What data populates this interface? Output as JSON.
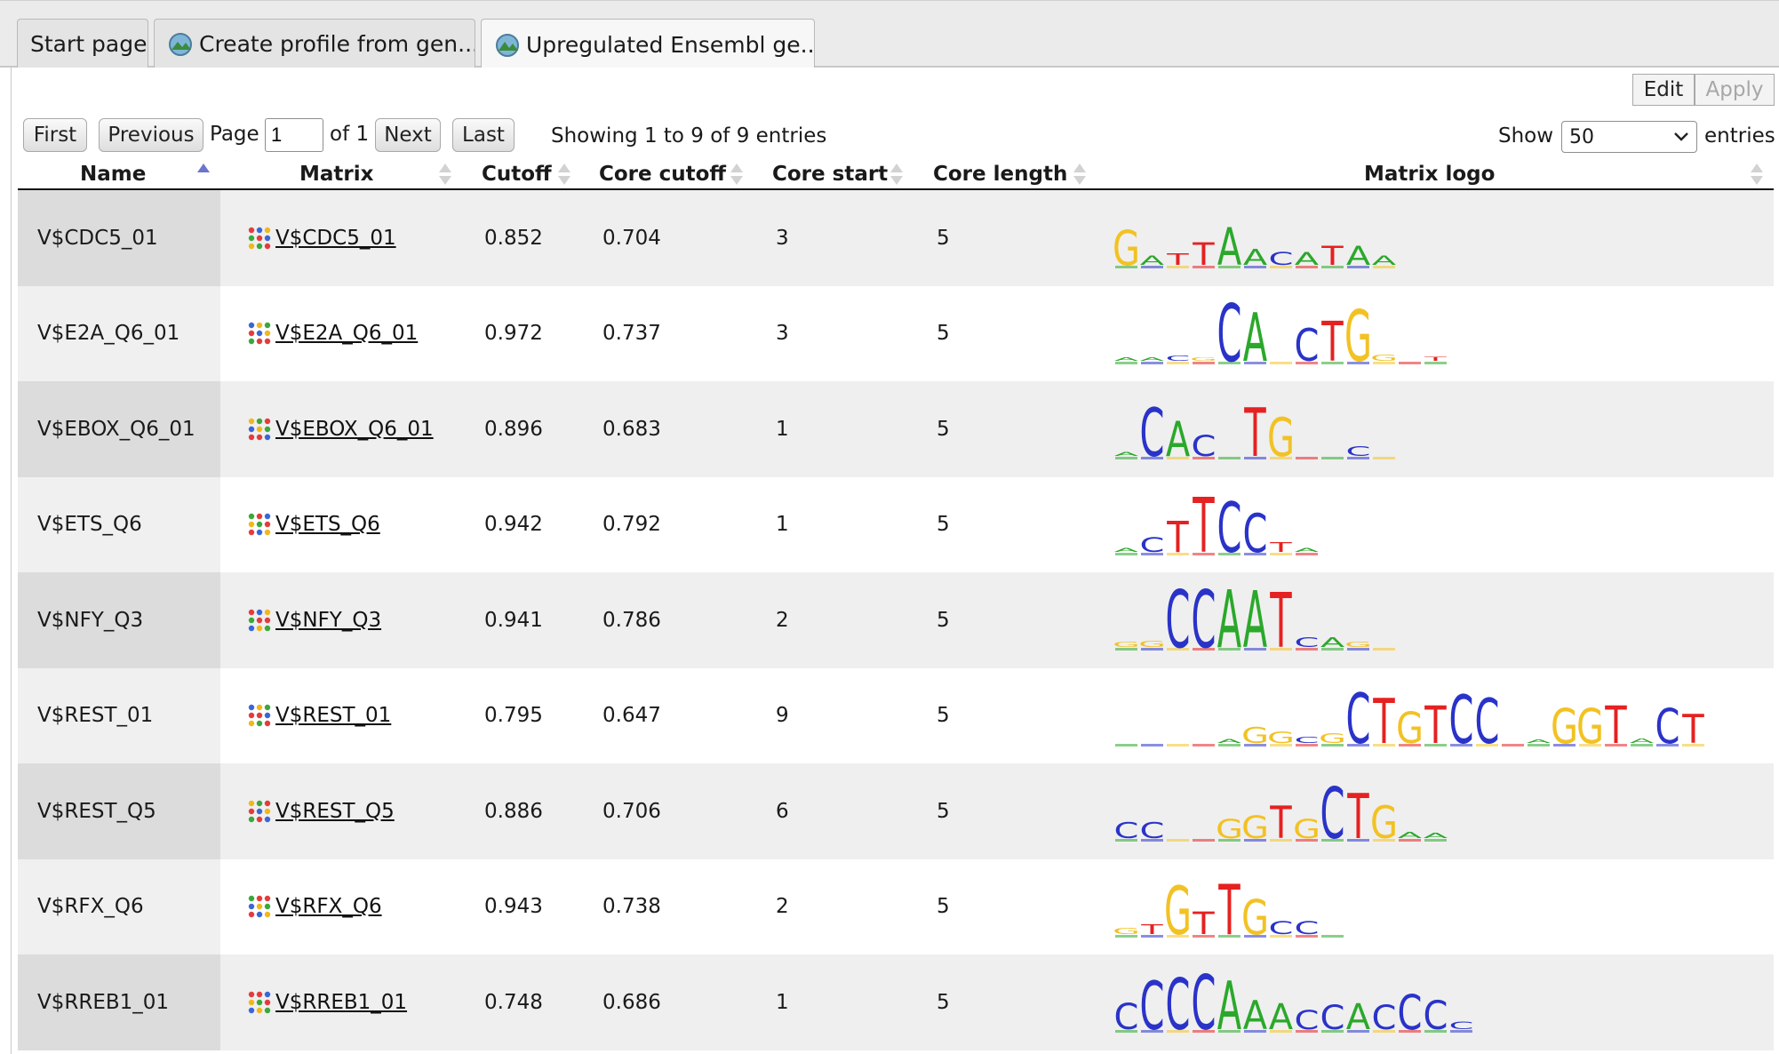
{
  "tabs": [
    {
      "label": "Start page"
    },
    {
      "label": "Create profile from gen...",
      "close": "X"
    },
    {
      "label": "Upregulated Ensembl ge...",
      "close": "X"
    }
  ],
  "toolbar": {
    "edit_label": "Edit",
    "apply_label": "Apply"
  },
  "pager": {
    "first": "First",
    "previous": "Previous",
    "page_label": "Page",
    "page_value": "1",
    "of_label": "of 1",
    "next": "Next",
    "last": "Last",
    "info": "Showing 1 to 9 of 9 entries",
    "show_label": "Show",
    "show_value": "50",
    "entries_label": "entries"
  },
  "columns": {
    "name": "Name",
    "matrix": "Matrix",
    "cutoff": "Cutoff",
    "core_cutoff": "Core cutoff",
    "core_start": "Core start",
    "core_length": "Core length",
    "matrix_logo": "Matrix logo"
  },
  "colors": {
    "A": "#2ba82b",
    "C": "#2a33c8",
    "G": "#f2c224",
    "T": "#e52121"
  },
  "rows": [
    {
      "name": "V$CDC5_01",
      "matrix": "V$CDC5_01",
      "cutoff": "0.852",
      "core_cutoff": "0.704",
      "core_start": "3",
      "core_length": "5",
      "logo": [
        [
          "G",
          0.55
        ],
        [
          "A",
          0.14
        ],
        [
          "T",
          0.18
        ],
        [
          "T",
          0.35
        ],
        [
          "A",
          0.58
        ],
        [
          "A",
          0.25
        ],
        [
          "C",
          0.2
        ],
        [
          "A",
          0.2
        ],
        [
          "T",
          0.3
        ],
        [
          "A",
          0.3
        ],
        [
          "A",
          0.14
        ]
      ]
    },
    {
      "name": "V$E2A_Q6_01",
      "matrix": "V$E2A_Q6_01",
      "cutoff": "0.972",
      "core_cutoff": "0.737",
      "core_start": "3",
      "core_length": "5",
      "logo": [
        [
          "A",
          0.05
        ],
        [
          "A",
          0.05
        ],
        [
          "C",
          0.08
        ],
        [
          "G",
          0.05
        ],
        [
          "C",
          0.9
        ],
        [
          "A",
          0.75
        ],
        [
          "_",
          0.05
        ],
        [
          "C",
          0.5
        ],
        [
          "T",
          0.62
        ],
        [
          "G",
          0.8
        ],
        [
          "G",
          0.1
        ],
        [
          "_",
          0.0
        ],
        [
          "T",
          0.06
        ]
      ]
    },
    {
      "name": "V$EBOX_Q6_01",
      "matrix": "V$EBOX_Q6_01",
      "cutoff": "0.896",
      "core_cutoff": "0.683",
      "core_start": "1",
      "core_length": "5",
      "logo": [
        [
          "A",
          0.06
        ],
        [
          "C",
          0.75
        ],
        [
          "A",
          0.55
        ],
        [
          "C",
          0.32
        ],
        [
          "_",
          0.05
        ],
        [
          "T",
          0.75
        ],
        [
          "G",
          0.6
        ],
        [
          "_",
          0.03
        ],
        [
          "_",
          0.03
        ],
        [
          "C",
          0.15
        ],
        [
          "_",
          0.03
        ]
      ]
    },
    {
      "name": "V$ETS_Q6",
      "matrix": "V$ETS_Q6",
      "cutoff": "0.942",
      "core_cutoff": "0.792",
      "core_start": "1",
      "core_length": "5",
      "logo": [
        [
          "A",
          0.06
        ],
        [
          "C",
          0.22
        ],
        [
          "T",
          0.48
        ],
        [
          "T",
          0.85
        ],
        [
          "C",
          0.78
        ],
        [
          "C",
          0.6
        ],
        [
          "T",
          0.15
        ],
        [
          "A",
          0.06
        ]
      ]
    },
    {
      "name": "V$NFY_Q3",
      "matrix": "V$NFY_Q3",
      "cutoff": "0.941",
      "core_cutoff": "0.786",
      "core_start": "2",
      "core_length": "5",
      "logo": [
        [
          "G",
          0.08
        ],
        [
          "G",
          0.1
        ],
        [
          "C",
          0.9
        ],
        [
          "C",
          0.9
        ],
        [
          "A",
          0.9
        ],
        [
          "A",
          0.88
        ],
        [
          "T",
          0.85
        ],
        [
          "C",
          0.15
        ],
        [
          "A",
          0.15
        ],
        [
          "G",
          0.08
        ],
        [
          "_",
          0.04
        ]
      ]
    },
    {
      "name": "V$REST_01",
      "matrix": "V$REST_01",
      "cutoff": "0.795",
      "core_cutoff": "0.647",
      "core_start": "9",
      "core_length": "5",
      "logo": [
        [
          "_",
          0.02
        ],
        [
          "_",
          0.02
        ],
        [
          "_",
          0.0
        ],
        [
          "_",
          0.0
        ],
        [
          "A",
          0.06
        ],
        [
          "G",
          0.25
        ],
        [
          "G",
          0.18
        ],
        [
          "C",
          0.1
        ],
        [
          "G",
          0.15
        ],
        [
          "C",
          0.78
        ],
        [
          "T",
          0.7
        ],
        [
          "G",
          0.48
        ],
        [
          "T",
          0.58
        ],
        [
          "C",
          0.75
        ],
        [
          "C",
          0.7
        ],
        [
          "_",
          0.05
        ],
        [
          "A",
          0.05
        ],
        [
          "G",
          0.55
        ],
        [
          "G",
          0.55
        ],
        [
          "T",
          0.58
        ],
        [
          "A",
          0.07
        ],
        [
          "C",
          0.55
        ],
        [
          "T",
          0.45
        ]
      ]
    },
    {
      "name": "V$REST_Q5",
      "matrix": "V$REST_Q5",
      "cutoff": "0.886",
      "core_cutoff": "0.706",
      "core_start": "6",
      "core_length": "5",
      "logo": [
        [
          "C",
          0.25
        ],
        [
          "C",
          0.25
        ],
        [
          "_",
          0.0
        ],
        [
          "_",
          0.03
        ],
        [
          "G",
          0.3
        ],
        [
          "G",
          0.35
        ],
        [
          "T",
          0.5
        ],
        [
          "G",
          0.3
        ],
        [
          "C",
          0.8
        ],
        [
          "T",
          0.7
        ],
        [
          "G",
          0.5
        ],
        [
          "A",
          0.1
        ],
        [
          "A",
          0.08
        ]
      ]
    },
    {
      "name": "V$RFX_Q6",
      "matrix": "V$RFX_Q6",
      "cutoff": "0.943",
      "core_cutoff": "0.738",
      "core_start": "2",
      "core_length": "5",
      "logo": [
        [
          "G",
          0.1
        ],
        [
          "T",
          0.15
        ],
        [
          "G",
          0.75
        ],
        [
          "T",
          0.35
        ],
        [
          "T",
          0.78
        ],
        [
          "G",
          0.55
        ],
        [
          "C",
          0.2
        ],
        [
          "C",
          0.2
        ],
        [
          "_",
          0.0
        ]
      ]
    },
    {
      "name": "V$RREB1_01",
      "matrix": "V$RREB1_01",
      "cutoff": "0.748",
      "core_cutoff": "0.686",
      "core_start": "1",
      "core_length": "5",
      "logo": [
        [
          "C",
          0.4
        ],
        [
          "C",
          0.75
        ],
        [
          "C",
          0.8
        ],
        [
          "C",
          0.85
        ],
        [
          "A",
          0.75
        ],
        [
          "A",
          0.45
        ],
        [
          "A",
          0.4
        ],
        [
          "C",
          0.3
        ],
        [
          "C",
          0.38
        ],
        [
          "A",
          0.4
        ],
        [
          "C",
          0.38
        ],
        [
          "C",
          0.55
        ],
        [
          "C",
          0.45
        ],
        [
          "C",
          0.12
        ]
      ]
    }
  ]
}
